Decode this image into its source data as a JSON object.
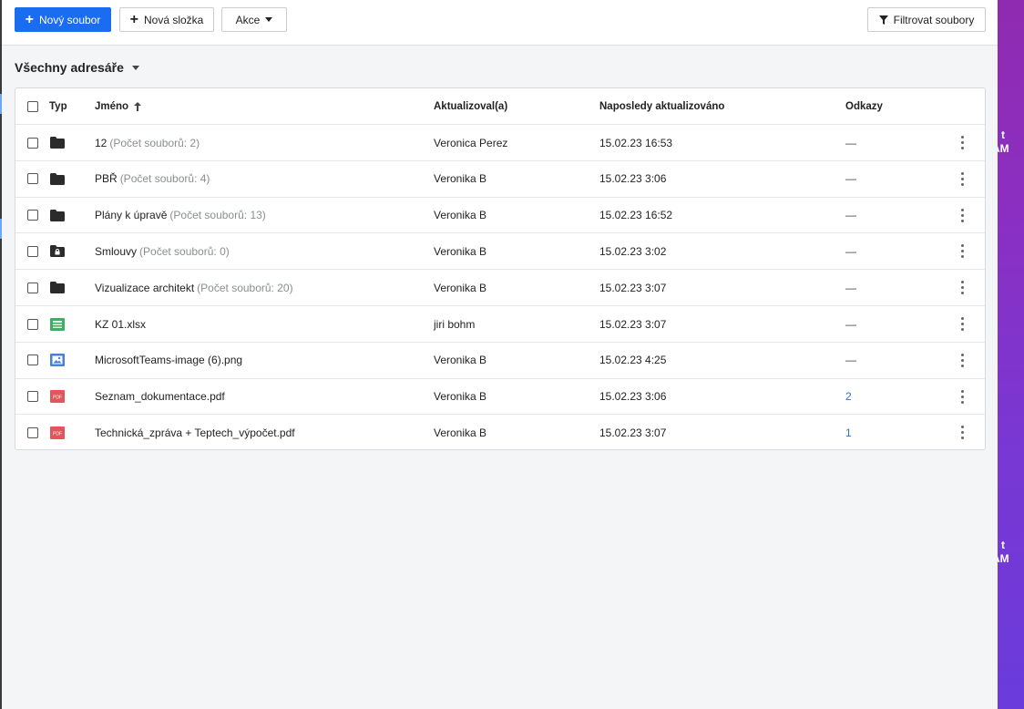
{
  "toolbar": {
    "new_file": "Nový soubor",
    "new_folder": "Nová složka",
    "actions": "Akce",
    "filter": "Filtrovat soubory"
  },
  "directory": {
    "title": "Všechny adresáře"
  },
  "table": {
    "headers": {
      "type": "Typ",
      "name": "Jméno",
      "updated_by": "Aktualizoval(a)",
      "last_updated": "Naposledy aktualizováno",
      "links": "Odkazy"
    },
    "rows": [
      {
        "icon": "folder-icon",
        "name": "12",
        "count": "(Počet souborů: 2)",
        "updated_by": "Veronica Perez",
        "date": "15.02.23 16:53",
        "links": "—"
      },
      {
        "icon": "folder-icon",
        "name": "PBŘ",
        "count": "(Počet souborů: 4)",
        "updated_by": "Veronika B",
        "date": "15.02.23 3:06",
        "links": "—"
      },
      {
        "icon": "folder-icon",
        "name": "Plány k úpravě",
        "count": "(Počet souborů: 13)",
        "updated_by": "Veronika B",
        "date": "15.02.23 16:52",
        "links": "—"
      },
      {
        "icon": "locked-folder-icon",
        "name": "Smlouvy",
        "count": "(Počet souborů: 0)",
        "updated_by": "Veronika B",
        "date": "15.02.23 3:02",
        "links": "—"
      },
      {
        "icon": "folder-icon",
        "name": "Vizualizace architekt",
        "count": "(Počet souborů: 20)",
        "updated_by": "Veronika B",
        "date": "15.02.23 3:07",
        "links": "—"
      },
      {
        "icon": "spreadsheet-icon",
        "name": "KZ 01.xlsx",
        "count": "",
        "updated_by": "jiri bohm",
        "date": "15.02.23 3:07",
        "links": "—"
      },
      {
        "icon": "image-file-icon",
        "name": "MicrosoftTeams-image (6).png",
        "count": "",
        "updated_by": "Veronika B",
        "date": "15.02.23 4:25",
        "links": "—"
      },
      {
        "icon": "pdf-icon",
        "name": "Seznam_dokumentace.pdf",
        "count": "",
        "updated_by": "Veronika B",
        "date": "15.02.23 3:06",
        "links": "2"
      },
      {
        "icon": "pdf-icon",
        "name": "Technická_zpráva + Teptech_výpočet.pdf",
        "count": "",
        "updated_by": "Veronika B",
        "date": "15.02.23 3:07",
        "links": "1"
      }
    ]
  },
  "desktop": {
    "clock_top": [
      "t",
      "AM"
    ],
    "clock_bottom": [
      "t",
      "AM"
    ]
  },
  "colors": {
    "primary": "#1a6cf0",
    "link": "#2a73c9",
    "spreadsheet": "#3fae62",
    "image": "#4a7fd6",
    "pdf": "#e2555a"
  }
}
